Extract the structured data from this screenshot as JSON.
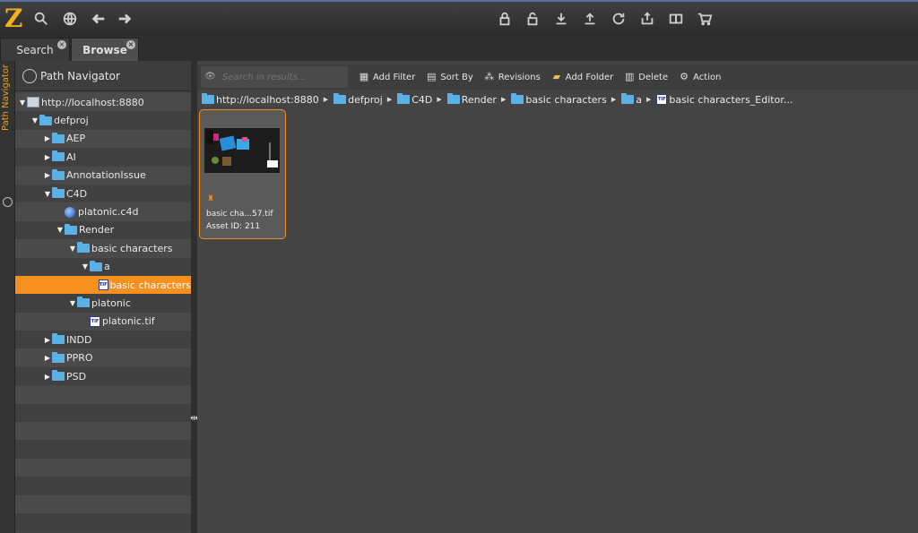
{
  "app": {
    "logo": "Z"
  },
  "topbar": {
    "icons": [
      "search-icon",
      "globe-icon",
      "back-arrow-icon",
      "forward-arrow-icon",
      "lock-icon",
      "unlock-icon",
      "download-icon",
      "upload-icon",
      "refresh-icon",
      "export-icon",
      "compare-icon",
      "cart-icon"
    ]
  },
  "tabs": [
    {
      "label": "Search"
    },
    {
      "label": "Browse"
    }
  ],
  "side_strip": {
    "label": "Path Navigator"
  },
  "navigator": {
    "title": "Path Navigator",
    "tree": [
      {
        "label": "http://localhost:8880",
        "icon": "server",
        "indent": 0,
        "expanded": true
      },
      {
        "label": "defproj",
        "icon": "folder",
        "indent": 1,
        "expanded": true
      },
      {
        "label": "AEP",
        "icon": "folder",
        "indent": 2,
        "expanded": false
      },
      {
        "label": "AI",
        "icon": "folder",
        "indent": 2,
        "expanded": false
      },
      {
        "label": "AnnotationIssue",
        "icon": "folder",
        "indent": 2,
        "expanded": false
      },
      {
        "label": "C4D",
        "icon": "folder",
        "indent": 2,
        "expanded": true
      },
      {
        "label": "platonic.c4d",
        "icon": "c4d",
        "indent": 3,
        "expanded": null
      },
      {
        "label": "Render",
        "icon": "folder",
        "indent": 3,
        "expanded": true
      },
      {
        "label": "basic characters",
        "icon": "folder",
        "indent": 4,
        "expanded": true
      },
      {
        "label": "a",
        "icon": "folder",
        "indent": 5,
        "expanded": true
      },
      {
        "label": "basic characters",
        "icon": "tif",
        "indent": 6,
        "expanded": null,
        "selected": true
      },
      {
        "label": "platonic",
        "icon": "folder",
        "indent": 4,
        "expanded": true
      },
      {
        "label": "platonic.tif",
        "icon": "tif",
        "indent": 5,
        "expanded": null
      },
      {
        "label": "INDD",
        "icon": "folder",
        "indent": 2,
        "expanded": false
      },
      {
        "label": "PPRO",
        "icon": "folder",
        "indent": 2,
        "expanded": false
      },
      {
        "label": "PSD",
        "icon": "folder",
        "indent": 2,
        "expanded": false
      },
      {
        "label": "",
        "icon": "",
        "indent": 0,
        "expanded": null
      },
      {
        "label": "",
        "icon": "",
        "indent": 0,
        "expanded": null
      },
      {
        "label": "",
        "icon": "",
        "indent": 0,
        "expanded": null
      },
      {
        "label": "",
        "icon": "",
        "indent": 0,
        "expanded": null
      },
      {
        "label": "",
        "icon": "",
        "indent": 0,
        "expanded": null
      },
      {
        "label": "",
        "icon": "",
        "indent": 0,
        "expanded": null
      },
      {
        "label": "",
        "icon": "",
        "indent": 0,
        "expanded": null
      },
      {
        "label": "",
        "icon": "",
        "indent": 0,
        "expanded": null
      }
    ]
  },
  "toolbar": {
    "search_placeholder": "Search in results...",
    "buttons": [
      {
        "label": "Add Filter",
        "icon": "filter-icon"
      },
      {
        "label": "Sort By",
        "icon": "sort-icon"
      },
      {
        "label": "Revisions",
        "icon": "revisions-icon"
      },
      {
        "label": "Add Folder",
        "icon": "add-folder-icon"
      },
      {
        "label": "Delete",
        "icon": "trash-icon"
      },
      {
        "label": "Action",
        "icon": "gear-icon"
      }
    ]
  },
  "breadcrumb": [
    {
      "label": "http://localhost:8880",
      "icon": "folder"
    },
    {
      "label": "defproj",
      "icon": "folder"
    },
    {
      "label": "C4D",
      "icon": "folder"
    },
    {
      "label": "Render",
      "icon": "folder"
    },
    {
      "label": "basic characters",
      "icon": "folder"
    },
    {
      "label": "a",
      "icon": "folder"
    },
    {
      "label": "basic characters_Editor...",
      "icon": "tif"
    }
  ],
  "asset": {
    "name": "basic cha...57.tif",
    "asset_id": "Asset ID: 211"
  },
  "colors": {
    "accent": "#f7901e",
    "folder": "#5bb0e6",
    "logo": "#f2b01e"
  }
}
